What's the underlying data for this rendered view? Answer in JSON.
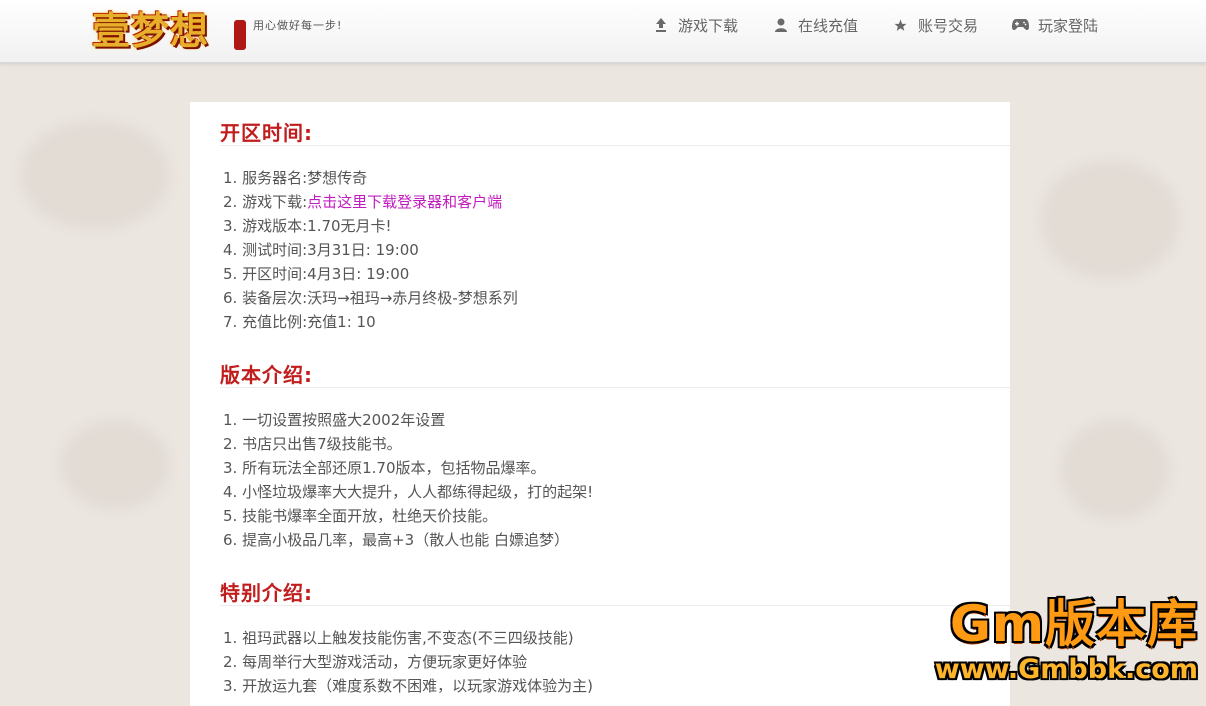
{
  "header": {
    "logo_text": "壹梦想",
    "slogan": "用心做好每一步!",
    "nav": [
      {
        "label": "游戏下载",
        "icon": "download-icon"
      },
      {
        "label": "在线充值",
        "icon": "user-icon"
      },
      {
        "label": "账号交易",
        "icon": "star-icon"
      },
      {
        "label": "玩家登陆",
        "icon": "gamepad-icon"
      }
    ]
  },
  "sections": [
    {
      "title": "开区时间:",
      "items": [
        {
          "num": "1.",
          "label": "服务器名:",
          "value": "梦想传奇"
        },
        {
          "num": "2.",
          "label": "游戏下载:",
          "link": "点击这里下载登录器和客户端"
        },
        {
          "num": "3.",
          "label": "游戏版本:",
          "value": "1.70无月卡!"
        },
        {
          "num": "4.",
          "label": "测试时间:",
          "value": "3月31日: 19:00"
        },
        {
          "num": "5.",
          "label": "开区时间:",
          "value": "4月3日: 19:00"
        },
        {
          "num": "6.",
          "label": "装备层次:",
          "value": "沃玛→祖玛→赤月终极-梦想系列"
        },
        {
          "num": "7.",
          "label": "充值比例:",
          "value": "充值1: 10"
        }
      ]
    },
    {
      "title": "版本介绍:",
      "items": [
        {
          "num": "1.",
          "text": "一切设置按照盛大2002年设置"
        },
        {
          "num": "2.",
          "text": "书店只出售7级技能书。"
        },
        {
          "num": "3.",
          "text": "所有玩法全部还原1.70版本，包括物品爆率。"
        },
        {
          "num": "4.",
          "text": "小怪垃圾爆率大大提升，人人都练得起级，打的起架!"
        },
        {
          "num": "5.",
          "text": "技能书爆率全面开放，杜绝天价技能。"
        },
        {
          "num": "6.",
          "text": "提高小极品几率，最高+3（散人也能 白嫖追梦）"
        }
      ]
    },
    {
      "title": "特别介绍:",
      "items": [
        {
          "num": "1.",
          "text": "祖玛武器以上触发技能伤害,不变态(不三四级技能)"
        },
        {
          "num": "2.",
          "text": "每周举行大型游戏活动，方便玩家更好体验"
        },
        {
          "num": "3.",
          "text": "开放运九套（难度系数不困难，以玩家游戏体验为主)"
        }
      ]
    }
  ],
  "watermark": {
    "line1": "Gm版本库",
    "line2": "www.Gmbbk.com"
  },
  "colors": {
    "section_title": "#c11d1d",
    "link": "#c21cc0",
    "text": "#555555",
    "page_bg": "#ece6e1"
  }
}
